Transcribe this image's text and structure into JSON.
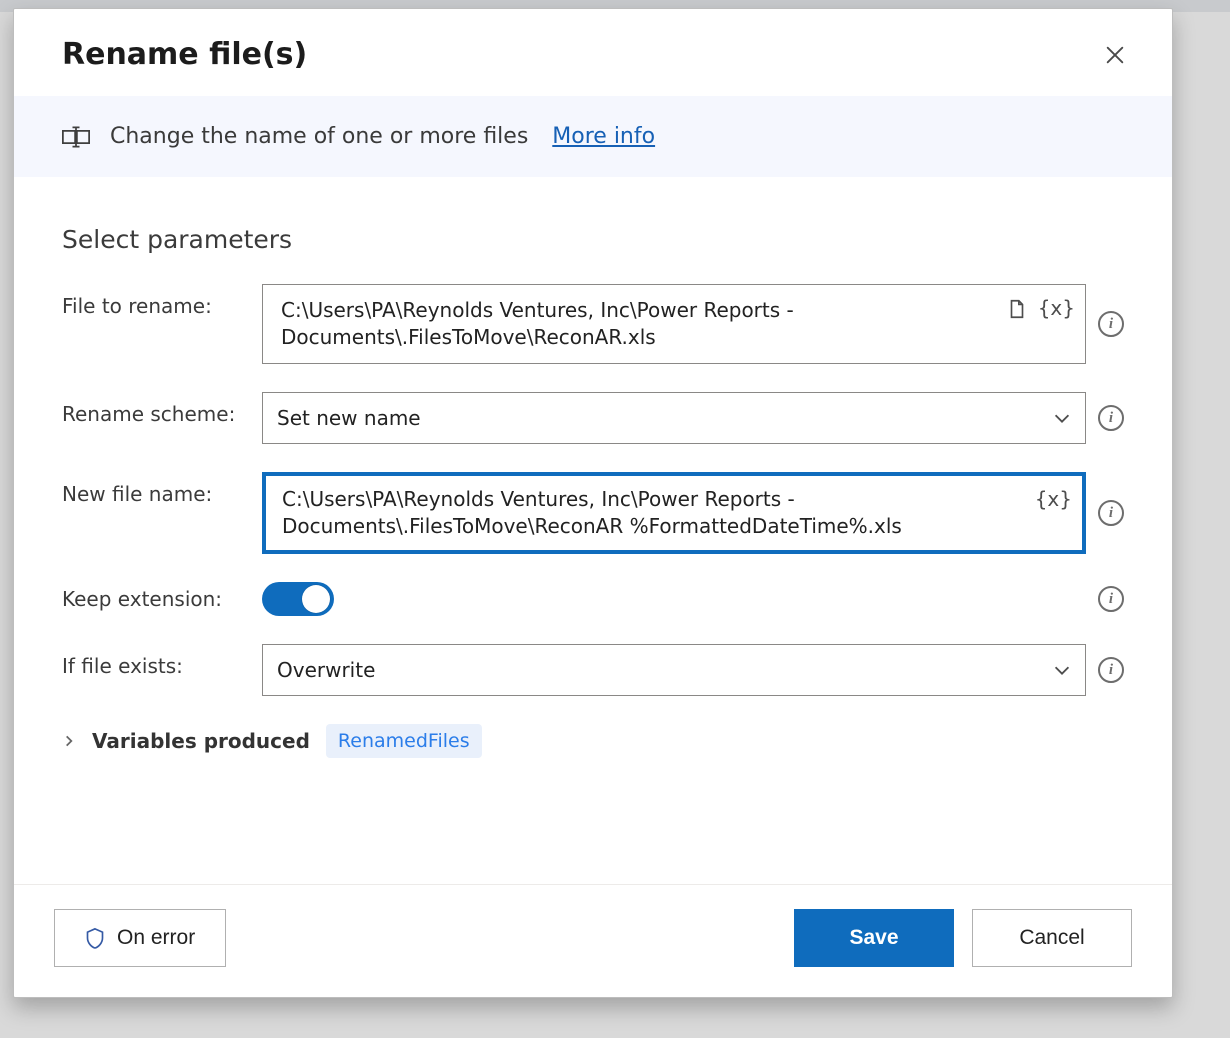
{
  "dialog": {
    "title": "Rename file(s)",
    "description": "Change the name of one or more files",
    "more_info": "More info",
    "section_title": "Select parameters",
    "fields": {
      "file_to_rename": {
        "label": "File to rename:",
        "value": "C:\\Users\\PA\\Reynolds Ventures, Inc\\Power Reports - Documents\\.FilesToMove\\ReconAR.xls"
      },
      "rename_scheme": {
        "label": "Rename scheme:",
        "selected": "Set new name"
      },
      "new_file_name": {
        "label": "New file name:",
        "value": "C:\\Users\\PA\\Reynolds Ventures, Inc\\Power Reports - Documents\\.FilesToMove\\ReconAR %FormattedDateTime%.xls"
      },
      "keep_extension": {
        "label": "Keep extension:",
        "value": true
      },
      "if_file_exists": {
        "label": "If file exists:",
        "selected": "Overwrite"
      }
    },
    "variables_produced": {
      "label": "Variables produced",
      "chips": [
        "RenamedFiles"
      ]
    },
    "buttons": {
      "on_error": "On error",
      "save": "Save",
      "cancel": "Cancel"
    },
    "glyphs": {
      "var_token": "{x}"
    }
  }
}
